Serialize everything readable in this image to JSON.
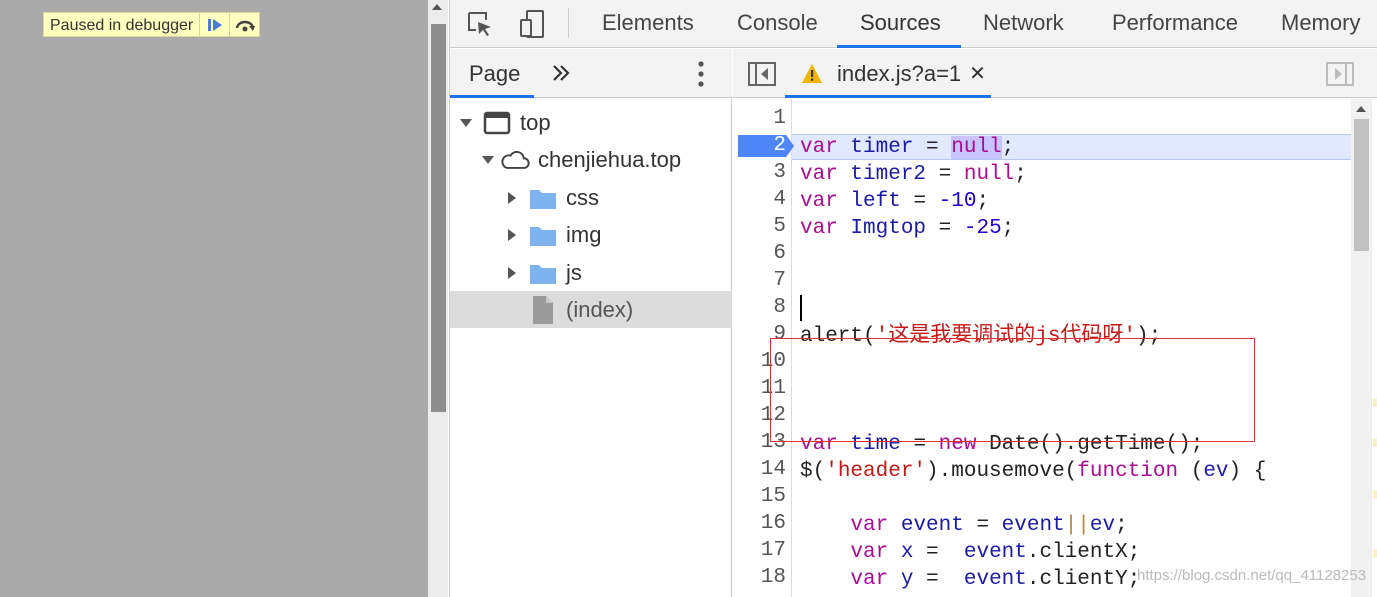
{
  "page": {
    "paused_label": "Paused in debugger",
    "resume_icon": "resume-icon",
    "step_over_icon": "step-over-icon"
  },
  "devtools": {
    "tabs": [
      {
        "label": "Elements"
      },
      {
        "label": "Console"
      },
      {
        "label": "Sources",
        "active": true
      },
      {
        "label": "Network"
      },
      {
        "label": "Performance"
      },
      {
        "label": "Memory"
      }
    ],
    "accent": "#1a73e8"
  },
  "navigator": {
    "tab_label": "Page",
    "tree": [
      {
        "label": "top",
        "icon": "frame-icon",
        "expanded": true
      },
      {
        "label": "chenjiehua.top",
        "icon": "cloud-icon",
        "expanded": true
      },
      {
        "label": "css",
        "icon": "folder-icon",
        "expanded": false
      },
      {
        "label": "img",
        "icon": "folder-icon",
        "expanded": false
      },
      {
        "label": "js",
        "icon": "folder-icon",
        "expanded": false
      },
      {
        "label": "(index)",
        "icon": "file-icon",
        "selected": true
      }
    ]
  },
  "editor": {
    "file_name": "index.js?a=1",
    "paused_line": 2,
    "line_numbers": [
      "1",
      "2",
      "3",
      "4",
      "5",
      "6",
      "7",
      "8",
      "9",
      "10",
      "11",
      "12",
      "13",
      "14",
      "15",
      "16",
      "17",
      "18"
    ],
    "lines": [
      "",
      "var timer = null;",
      "var timer2 = null;",
      "var left = -10;",
      "var Imgtop = -25;",
      "",
      "",
      "",
      "alert('这是我要调试的js代码呀');",
      "",
      "",
      "",
      "var time = new Date().getTime();",
      "$('header').mousemove(function (ev) {",
      "",
      "    var event = event||ev;",
      "    var x =  event.clientX;",
      "    var y =  event.clientY;"
    ]
  },
  "watermark": "https://blog.csdn.net/qq_41128253"
}
